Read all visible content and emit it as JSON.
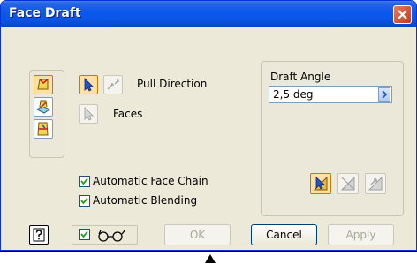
{
  "window": {
    "title": "Face Draft"
  },
  "left_tools": [
    {
      "name": "draft-mode-fixed-edge-icon"
    },
    {
      "name": "draft-mode-fixed-plane-icon"
    },
    {
      "name": "draft-mode-parting-line-icon"
    }
  ],
  "selection": {
    "pull_direction_label": "Pull Direction",
    "faces_label": "Faces"
  },
  "draft_angle": {
    "label": "Draft Angle",
    "value": "2,5 deg"
  },
  "options": {
    "automatic_face_chain": {
      "label": "Automatic Face Chain",
      "checked": true
    },
    "automatic_blending": {
      "label": "Automatic Blending",
      "checked": true
    }
  },
  "buttons": {
    "ok": "OK",
    "cancel": "Cancel",
    "apply": "Apply"
  },
  "colors": {
    "title_bar": "#0a58ef",
    "dialog_bg": "#ece9d8",
    "close_button": "#c4391c"
  }
}
